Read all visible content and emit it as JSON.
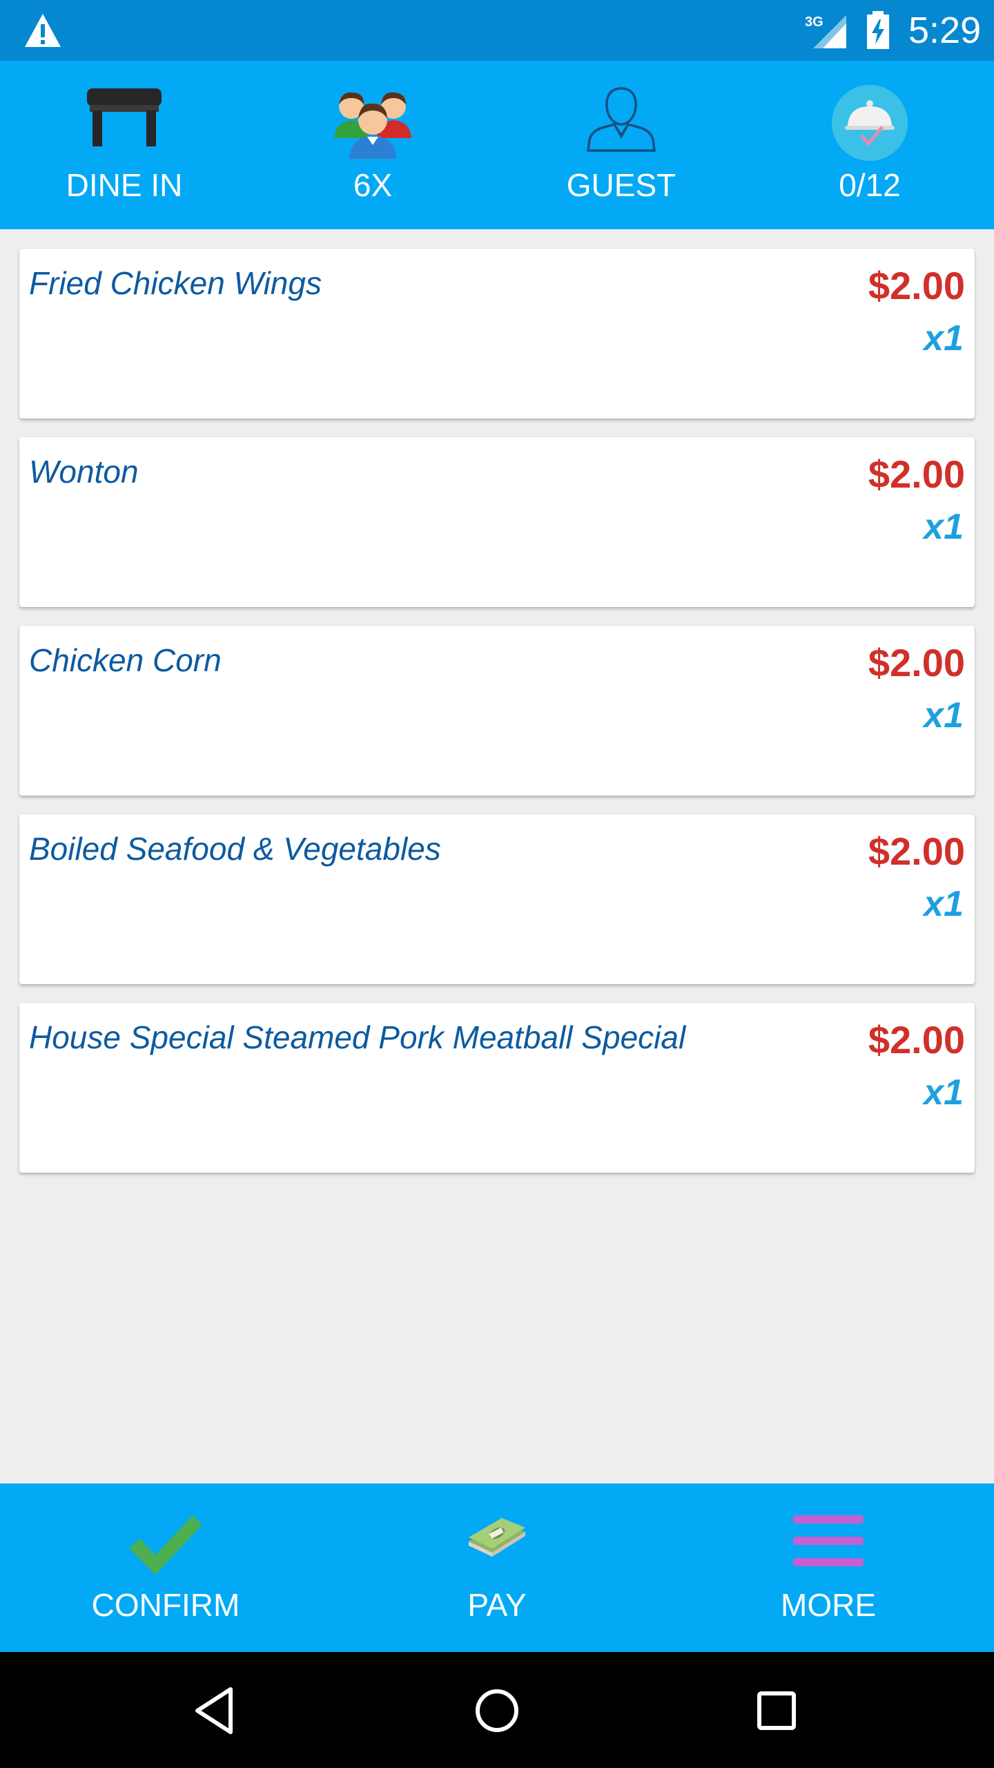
{
  "status_bar": {
    "time": "5:29",
    "network": "3G",
    "icons": [
      "warning-icon",
      "signal-icon",
      "battery-charging-icon"
    ]
  },
  "top_bar": {
    "items": [
      {
        "label": "DINE IN",
        "icon": "table-icon"
      },
      {
        "label": "6X",
        "icon": "group-icon"
      },
      {
        "label": "GUEST",
        "icon": "user-icon"
      },
      {
        "label": "0/12",
        "icon": "cloche-icon"
      }
    ]
  },
  "order_items": [
    {
      "name": "Fried Chicken Wings",
      "price": "$2.00",
      "qty": "x1"
    },
    {
      "name": "Wonton",
      "price": "$2.00",
      "qty": "x1"
    },
    {
      "name": "Chicken Corn",
      "price": "$2.00",
      "qty": "x1"
    },
    {
      "name": "Boiled Seafood & Vegetables",
      "price": "$2.00",
      "qty": "x1"
    },
    {
      "name": "House Special Steamed Pork Meatball Special",
      "price": "$2.00",
      "qty": "x1"
    }
  ],
  "bottom_bar": {
    "confirm_label": "CONFIRM",
    "pay_label": "PAY",
    "more_label": "MORE"
  },
  "colors": {
    "status_bar": "#0688d1",
    "toolbar": "#03a9f4",
    "price": "#d0302a",
    "qty": "#1ea0e0",
    "item_name": "#0d5aa0",
    "background": "#eeeeee"
  }
}
